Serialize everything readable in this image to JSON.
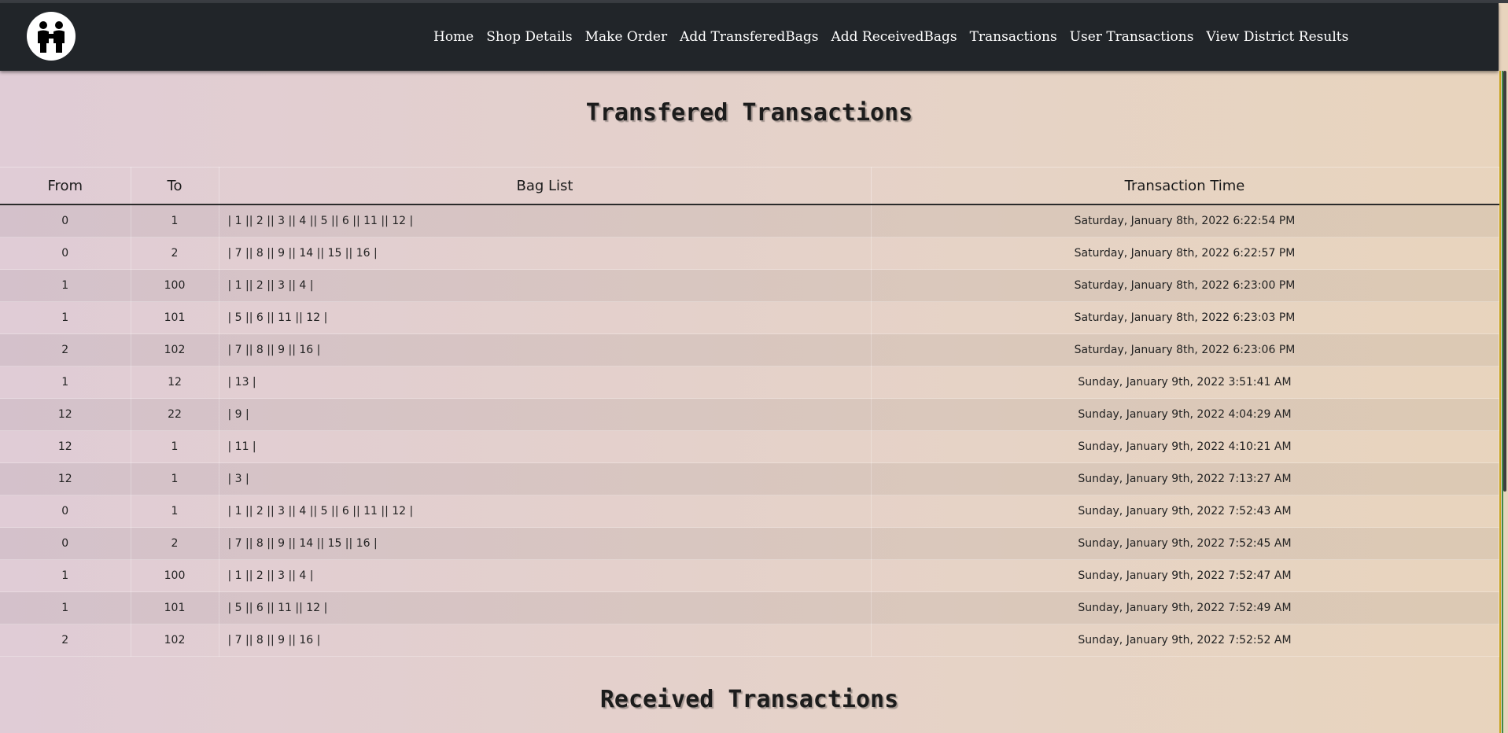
{
  "navbar": {
    "logo_icon": "people-exchange-icon",
    "links": [
      "Home",
      "Shop Details",
      "Make Order",
      "Add TransferedBags",
      "Add ReceivedBags",
      "Transactions",
      "User Transactions",
      "View District Results"
    ]
  },
  "transfered": {
    "title": "Transfered Transactions",
    "headers": {
      "from": "From",
      "to": "To",
      "bag_list": "Bag List",
      "time": "Transaction Time"
    },
    "rows": [
      {
        "from": "0",
        "to": "1",
        "bags": "| 1 || 2 || 3 || 4 || 5 || 6 || 11 || 12 |",
        "time": "Saturday, January 8th, 2022 6:22:54 PM"
      },
      {
        "from": "0",
        "to": "2",
        "bags": "| 7 || 8 || 9 || 14 || 15 || 16 |",
        "time": "Saturday, January 8th, 2022 6:22:57 PM"
      },
      {
        "from": "1",
        "to": "100",
        "bags": "| 1 || 2 || 3 || 4 |",
        "time": "Saturday, January 8th, 2022 6:23:00 PM"
      },
      {
        "from": "1",
        "to": "101",
        "bags": "| 5 || 6 || 11 || 12 |",
        "time": "Saturday, January 8th, 2022 6:23:03 PM"
      },
      {
        "from": "2",
        "to": "102",
        "bags": "| 7 || 8 || 9 || 16 |",
        "time": "Saturday, January 8th, 2022 6:23:06 PM"
      },
      {
        "from": "1",
        "to": "12",
        "bags": "| 13 |",
        "time": "Sunday, January 9th, 2022 3:51:41 AM"
      },
      {
        "from": "12",
        "to": "22",
        "bags": "| 9 |",
        "time": "Sunday, January 9th, 2022 4:04:29 AM"
      },
      {
        "from": "12",
        "to": "1",
        "bags": "| 11 |",
        "time": "Sunday, January 9th, 2022 4:10:21 AM"
      },
      {
        "from": "12",
        "to": "1",
        "bags": "| 3 |",
        "time": "Sunday, January 9th, 2022 7:13:27 AM"
      },
      {
        "from": "0",
        "to": "1",
        "bags": "| 1 || 2 || 3 || 4 || 5 || 6 || 11 || 12 |",
        "time": "Sunday, January 9th, 2022 7:52:43 AM"
      },
      {
        "from": "0",
        "to": "2",
        "bags": "| 7 || 8 || 9 || 14 || 15 || 16 |",
        "time": "Sunday, January 9th, 2022 7:52:45 AM"
      },
      {
        "from": "1",
        "to": "100",
        "bags": "| 1 || 2 || 3 || 4 |",
        "time": "Sunday, January 9th, 2022 7:52:47 AM"
      },
      {
        "from": "1",
        "to": "101",
        "bags": "| 5 || 6 || 11 || 12 |",
        "time": "Sunday, January 9th, 2022 7:52:49 AM"
      },
      {
        "from": "2",
        "to": "102",
        "bags": "| 7 || 8 || 9 || 16 |",
        "time": "Sunday, January 9th, 2022 7:52:52 AM"
      }
    ]
  },
  "received": {
    "title": "Received Transactions"
  },
  "colors": {
    "navbar_bg": "#212529",
    "nav_text": "#ffffff",
    "bg_left": "#e0ccd6",
    "bg_right": "#e8d4bd"
  }
}
